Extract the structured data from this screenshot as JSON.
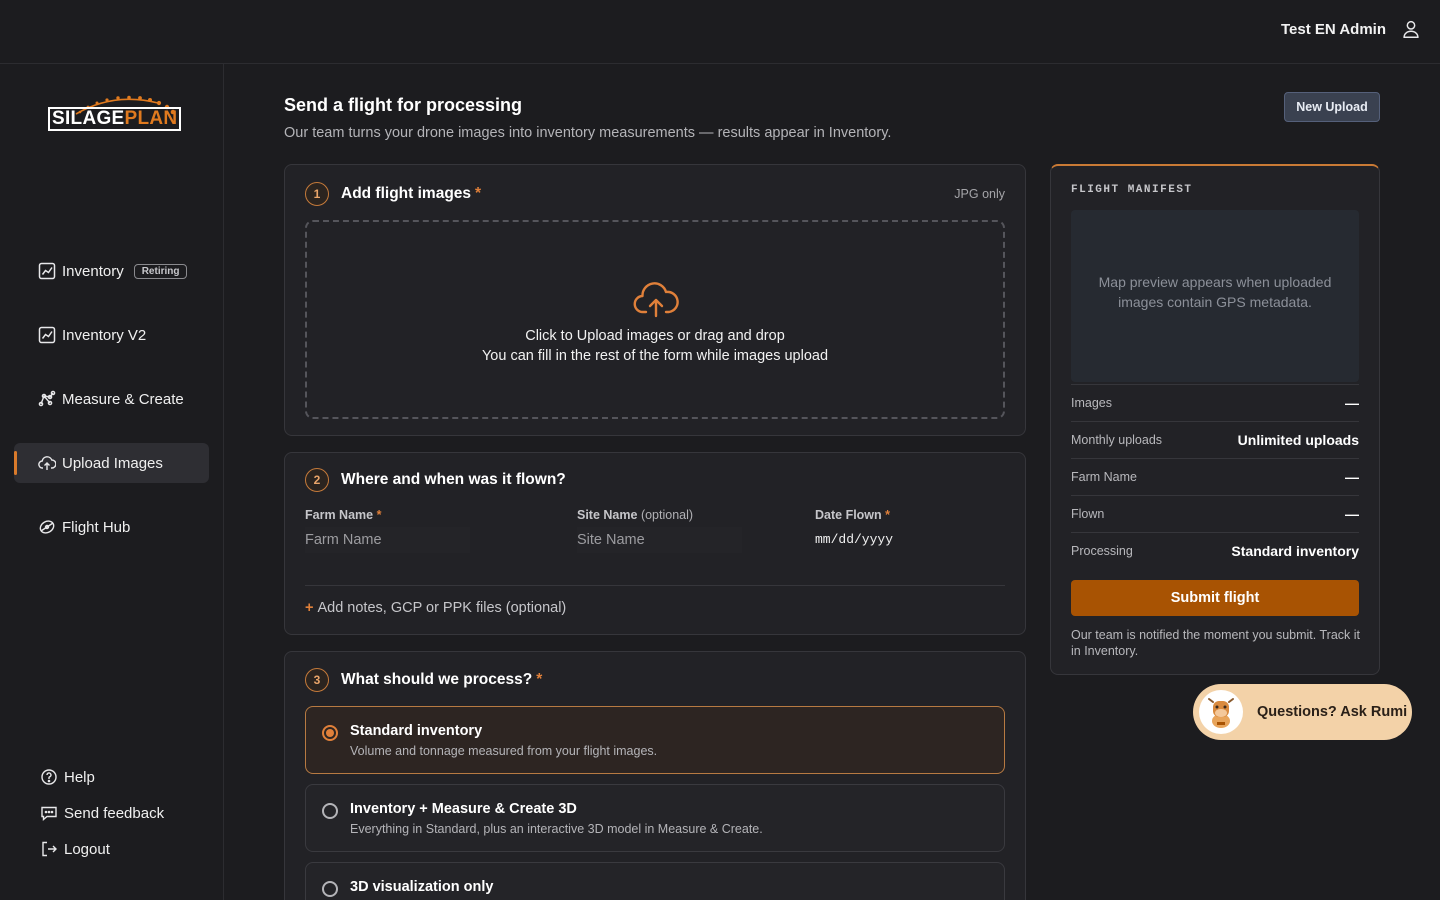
{
  "header": {
    "user_name": "Test EN Admin"
  },
  "logo": {
    "part1": "SILAGE",
    "part2": "PLAN"
  },
  "sidebar": {
    "items": [
      {
        "label": "Inventory",
        "badge": "Retiring"
      },
      {
        "label": "Inventory V2"
      },
      {
        "label": "Measure & Create"
      },
      {
        "label": "Upload Images"
      },
      {
        "label": "Flight Hub"
      }
    ],
    "footer": [
      {
        "label": "Help"
      },
      {
        "label": "Send feedback"
      },
      {
        "label": "Logout"
      }
    ]
  },
  "page": {
    "title": "Send a flight for processing",
    "subtitle": "Our team turns your drone images into inventory measurements — results appear in Inventory.",
    "new_upload_label": "New Upload"
  },
  "step1": {
    "num": "1",
    "title": "Add flight images",
    "required": "*",
    "format_note": "JPG only",
    "drop_line1": "Click to Upload images or drag and drop",
    "drop_line2": "You can fill in the rest of the form while images upload"
  },
  "step2": {
    "num": "2",
    "title": "Where and when was it flown?",
    "farm_label": "Farm Name",
    "farm_required": "*",
    "farm_placeholder": "Farm Name",
    "site_label": "Site Name",
    "site_optional": "(optional)",
    "site_placeholder": "Site Name",
    "date_label": "Date Flown",
    "date_required": "*",
    "date_value": "mm/dd/yyyy",
    "add_notes_plus": "+",
    "add_notes": "Add notes, GCP or PPK files (optional)"
  },
  "step3": {
    "num": "3",
    "title": "What should we process?",
    "required": "*",
    "options": [
      {
        "title": "Standard inventory",
        "desc": "Volume and tonnage measured from your flight images.",
        "selected": true
      },
      {
        "title": "Inventory + Measure & Create 3D",
        "desc": "Everything in Standard, plus an interactive 3D model in Measure & Create.",
        "selected": false
      },
      {
        "title": "3D visualization only",
        "desc": "",
        "selected": false
      }
    ]
  },
  "manifest": {
    "title": "FLIGHT MANIFEST",
    "map_text": "Map preview appears when uploaded images contain GPS metadata.",
    "rows": [
      {
        "key": "Images",
        "value": "—"
      },
      {
        "key": "Monthly uploads",
        "value": "Unlimited uploads"
      },
      {
        "key": "Farm Name",
        "value": "—"
      },
      {
        "key": "Flown",
        "value": "—"
      },
      {
        "key": "Processing",
        "value": "Standard inventory"
      }
    ],
    "submit_label": "Submit flight",
    "note": "Our team is notified the moment you submit. Track it in Inventory."
  },
  "rumi": {
    "label": "Questions? Ask Rumi"
  },
  "colors": {
    "accent": "#e0803a",
    "submit": "#a85303",
    "background": "#1c1c1f"
  },
  "icons": [
    "user-icon",
    "chart-icon",
    "measure-icon",
    "cloud-upload-icon",
    "drone-icon",
    "help-icon",
    "feedback-icon",
    "logout-icon",
    "upload-cloud-icon"
  ]
}
